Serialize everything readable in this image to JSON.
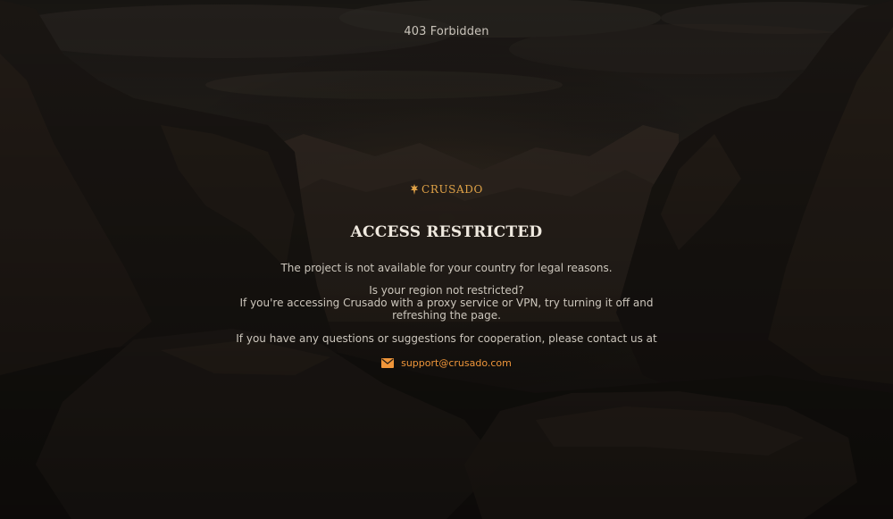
{
  "page": {
    "status_title": "403 Forbidden"
  },
  "brand": {
    "name": "CRUSADO",
    "logo_icon": "sword-emblem-icon",
    "accent_color": "#e0a247"
  },
  "notice": {
    "heading": "ACCESS RESTRICTED",
    "message": "The project is not available for your country for legal reasons.",
    "region_question": "Is your region not restricted?",
    "vpn_advice_line1": "If you're accessing Crusado with a proxy service or VPN, try turning it off and",
    "vpn_advice_line2": "refreshing the page.",
    "contact_prompt": "If you have any questions or suggestions for cooperation, please contact us at"
  },
  "contact": {
    "icon": "envelope-icon",
    "email": "support@crusado.com",
    "link_color": "#f0963a"
  },
  "background": {
    "scene": "mountain-valley-at-dusk-image"
  }
}
